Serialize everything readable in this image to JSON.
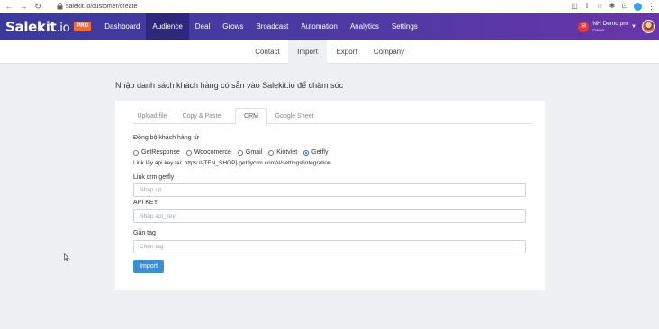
{
  "browser": {
    "back": "←",
    "forward": "→",
    "reload": "↻",
    "lock": "🔒",
    "url": "salekit.io/customer/create",
    "ext_icons": [
      "◫",
      "⇪",
      "☆",
      "✱",
      "⊡"
    ],
    "menu": "⋮"
  },
  "header": {
    "logo_main": "Salekit",
    "logo_suffix": ".io",
    "pro_badge": "PRO",
    "nav": [
      {
        "label": "Dashboard"
      },
      {
        "label": "Audience"
      },
      {
        "label": "Deal"
      },
      {
        "label": "Grows"
      },
      {
        "label": "Broadcast"
      },
      {
        "label": "Automation"
      },
      {
        "label": "Analytics"
      },
      {
        "label": "Settings"
      }
    ],
    "active_nav": "Audience",
    "user": {
      "name": "NH Demo pro",
      "role": "Owner",
      "mail_icon": "✉",
      "caret": "▼"
    }
  },
  "subnav": {
    "tabs": [
      {
        "label": "Contact"
      },
      {
        "label": "Import"
      },
      {
        "label": "Export"
      },
      {
        "label": "Company"
      }
    ],
    "active": "Import"
  },
  "page": {
    "title": "Nhập danh sách khách hàng có sẵn vào Salekit.io để chăm sóc"
  },
  "form": {
    "tabs": [
      {
        "label": "Upload file"
      },
      {
        "label": "Copy & Paste"
      },
      {
        "label": "CRM"
      },
      {
        "label": "Google Sheet"
      }
    ],
    "active_tab": "CRM",
    "sync_label": "Đồng bộ khách hàng từ",
    "sources": [
      {
        "label": "GetResponse",
        "checked": false
      },
      {
        "label": "Woocomerce",
        "checked": false
      },
      {
        "label": "Gmail",
        "checked": false
      },
      {
        "label": "Kiotviet",
        "checked": false
      },
      {
        "label": "Getfly",
        "checked": true
      }
    ],
    "hint": "Link lấy api key tại: https://{TEN_SHOP}.getflycrm.com/#/settings/integration",
    "link_label": "Link crm getfly",
    "link_placeholder": "Nhập url",
    "api_label": "API KEY",
    "api_placeholder": "Nhập api_key",
    "tag_label": "Gắn tag",
    "tag_placeholder": "Chọn tag",
    "import_button": "Import"
  },
  "colors": {
    "header_start": "#3b3a9c",
    "header_end": "#6a35a8",
    "pro_badge": "#f26b3a",
    "button": "#3d8fd4",
    "page_bg": "#eef0f3"
  }
}
